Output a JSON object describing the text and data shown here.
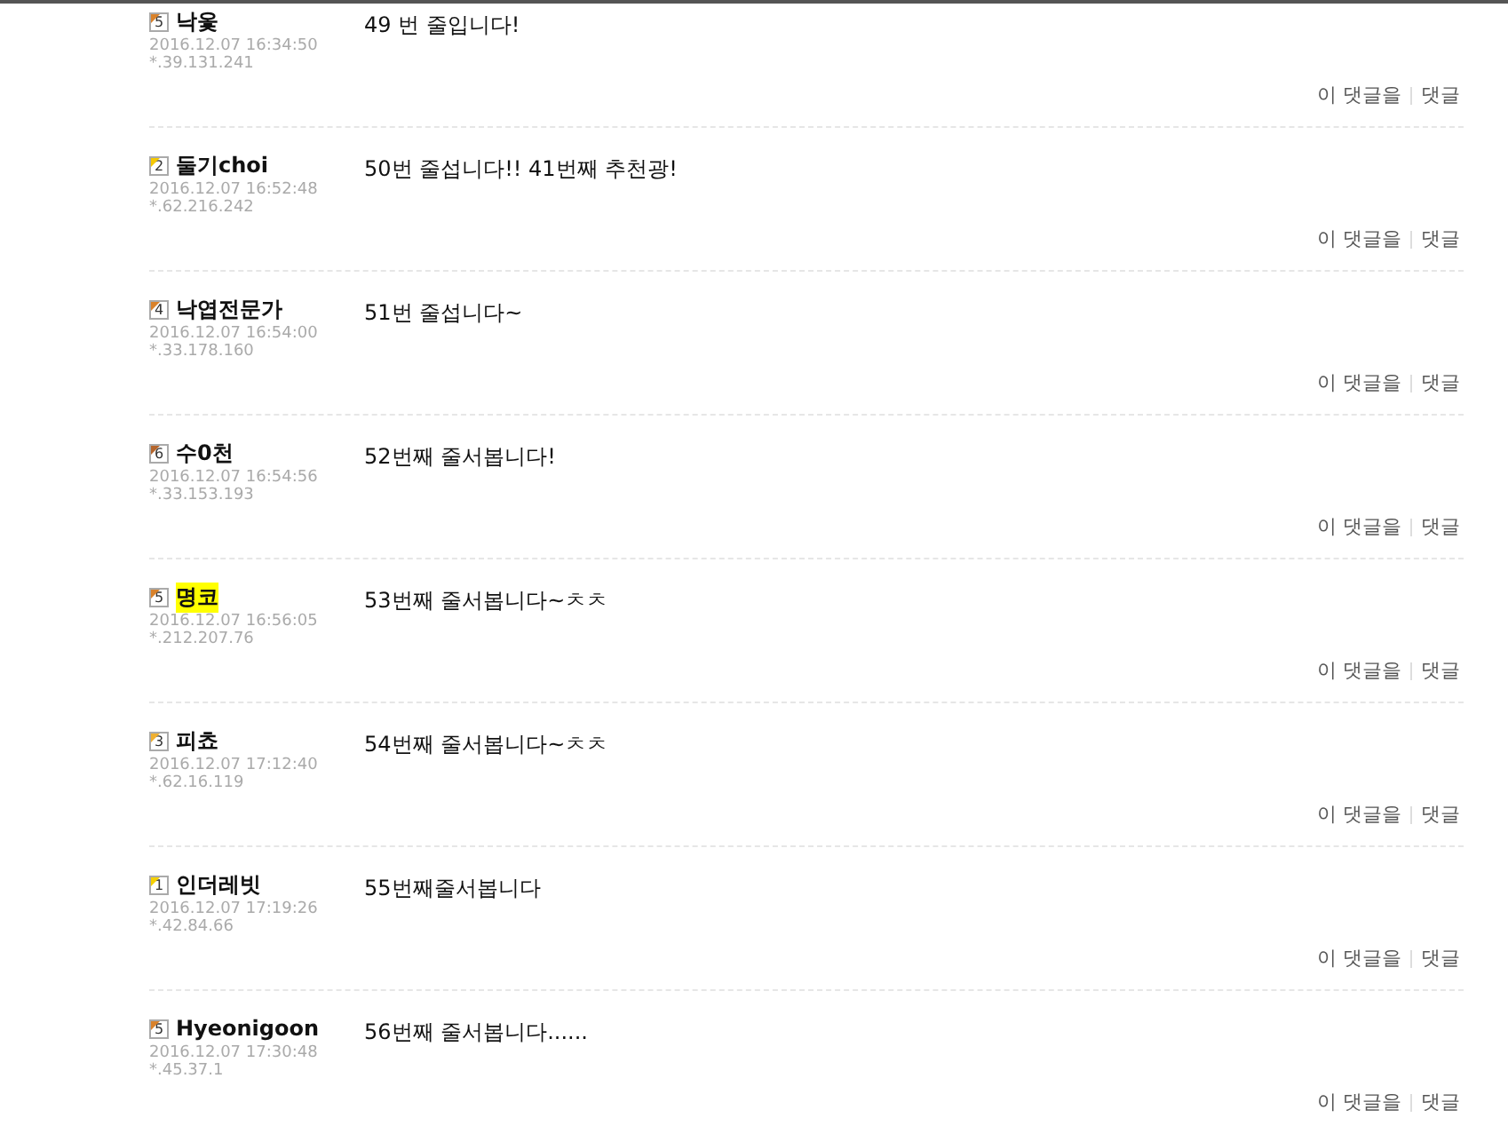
{
  "comments": [
    {
      "level": "5",
      "color": "#d9822b",
      "name": "낙옻",
      "highlighted": false,
      "date": "2016.12.07 16:34:50",
      "ip": "*.39.131.241",
      "text": "49 번 줄입니다!",
      "actions": [
        "이 댓글을",
        "댓글"
      ]
    },
    {
      "level": "2",
      "color": "#f5c800",
      "name": "둘기choi",
      "highlighted": false,
      "date": "2016.12.07 16:52:48",
      "ip": "*.62.216.242",
      "text": "50번 줄섭니다!! 41번째 추천광!",
      "actions": [
        "이 댓글을",
        "댓글"
      ]
    },
    {
      "level": "4",
      "color": "#d9822b",
      "name": "낙엽전문가",
      "highlighted": false,
      "date": "2016.12.07 16:54:00",
      "ip": "*.33.178.160",
      "text": "51번 줄섭니다~",
      "actions": [
        "이 댓글을",
        "댓글"
      ]
    },
    {
      "level": "6",
      "color": "#b5652b",
      "name": "수0천",
      "highlighted": false,
      "date": "2016.12.07 16:54:56",
      "ip": "*.33.153.193",
      "text": "52번째 줄서봅니다!",
      "actions": [
        "이 댓글을",
        "댓글"
      ]
    },
    {
      "level": "5",
      "color": "#d9822b",
      "name": "명코",
      "highlighted": true,
      "date": "2016.12.07 16:56:05",
      "ip": "*.212.207.76",
      "text": "53번째 줄서봅니다~ㅊㅊ",
      "actions": [
        "이 댓글을",
        "댓글"
      ]
    },
    {
      "level": "3",
      "color": "#f0b030",
      "name": "피쵸",
      "highlighted": false,
      "date": "2016.12.07 17:12:40",
      "ip": "*.62.16.119",
      "text": "54번째 줄서봅니다~ㅊㅊ",
      "actions": [
        "이 댓글을",
        "댓글"
      ]
    },
    {
      "level": "1",
      "color": "#f5d000",
      "name": "인더레빗",
      "highlighted": false,
      "date": "2016.12.07 17:19:26",
      "ip": "*.42.84.66",
      "text": "55번째줄서봅니다",
      "actions": [
        "이 댓글을",
        "댓글"
      ]
    },
    {
      "level": "5",
      "color": "#d9822b",
      "name": "Hyeonigoon",
      "highlighted": false,
      "date": "2016.12.07 17:30:48",
      "ip": "*.45.37.1",
      "text": "56번째 줄서봅니다......",
      "actions": [
        "이 댓글을",
        "댓글"
      ]
    }
  ]
}
